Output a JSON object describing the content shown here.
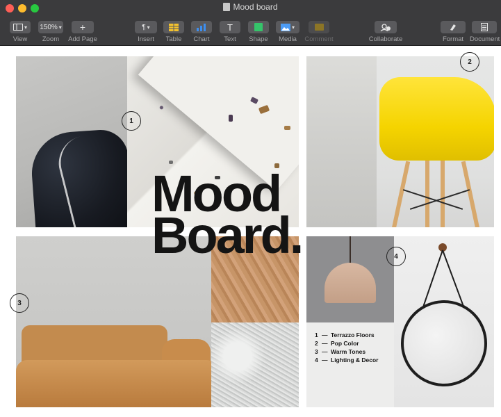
{
  "window": {
    "title": "Mood board"
  },
  "toolbar": {
    "items": [
      {
        "label": "View",
        "value": ""
      },
      {
        "label": "Zoom",
        "value": "150%"
      },
      {
        "label": "Add Page",
        "value": "+"
      },
      {
        "label": "Insert",
        "value": "¶"
      },
      {
        "label": "Table",
        "value": ""
      },
      {
        "label": "Chart",
        "value": ""
      },
      {
        "label": "Text",
        "value": "T"
      },
      {
        "label": "Shape",
        "value": ""
      },
      {
        "label": "Media",
        "value": ""
      },
      {
        "label": "Comment",
        "value": ""
      },
      {
        "label": "Collaborate",
        "value": ""
      },
      {
        "label": "Format",
        "value": ""
      },
      {
        "label": "Document",
        "value": ""
      }
    ],
    "accent_colors": {
      "table": "#f2c12e",
      "chart": "#3d8ff0",
      "shape": "#35c46a",
      "media": "#4d9cf5",
      "comment": "#c9a227"
    }
  },
  "document": {
    "headline": "Mood\nBoard.",
    "markers": [
      "1",
      "2",
      "3",
      "4"
    ],
    "legend": [
      {
        "num": "1",
        "text": "Terrazzo Floors"
      },
      {
        "num": "2",
        "text": "Pop Color"
      },
      {
        "num": "3",
        "text": "Warm Tones"
      },
      {
        "num": "4",
        "text": "Lighting & Decor"
      }
    ],
    "dash": "—"
  }
}
